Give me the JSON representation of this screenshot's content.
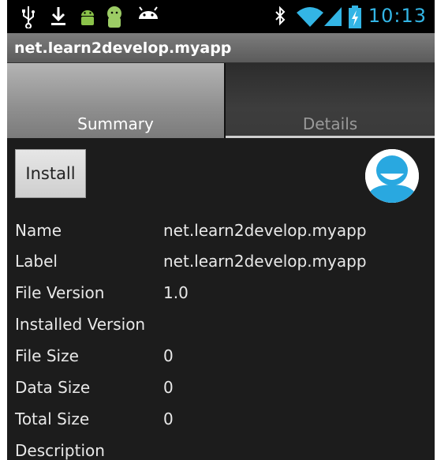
{
  "status_bar": {
    "time": "10:13",
    "left_icons": [
      "usb-icon",
      "download-icon",
      "android-icon",
      "android-debug-icon",
      "android-notification-icon"
    ],
    "right_icons": [
      "bluetooth-icon",
      "wifi-icon",
      "signal-icon",
      "battery-charging-icon"
    ],
    "accent": "#33b5e5"
  },
  "app_title": "net.learn2develop.myapp",
  "tabs": [
    {
      "label": "Summary",
      "selected": true
    },
    {
      "label": "Details",
      "selected": false
    }
  ],
  "install_button": "Install",
  "app_icon": "avatar-icon",
  "fields": [
    {
      "label": "Name",
      "value": "net.learn2develop.myapp"
    },
    {
      "label": "Label",
      "value": "net.learn2develop.myapp"
    },
    {
      "label": "File Version",
      "value": "1.0"
    },
    {
      "label": "Installed Version",
      "value": ""
    },
    {
      "label": "File Size",
      "value": "0"
    },
    {
      "label": "Data Size",
      "value": "0"
    },
    {
      "label": "Total Size",
      "value": "0"
    },
    {
      "label": "Description",
      "value": ""
    }
  ]
}
